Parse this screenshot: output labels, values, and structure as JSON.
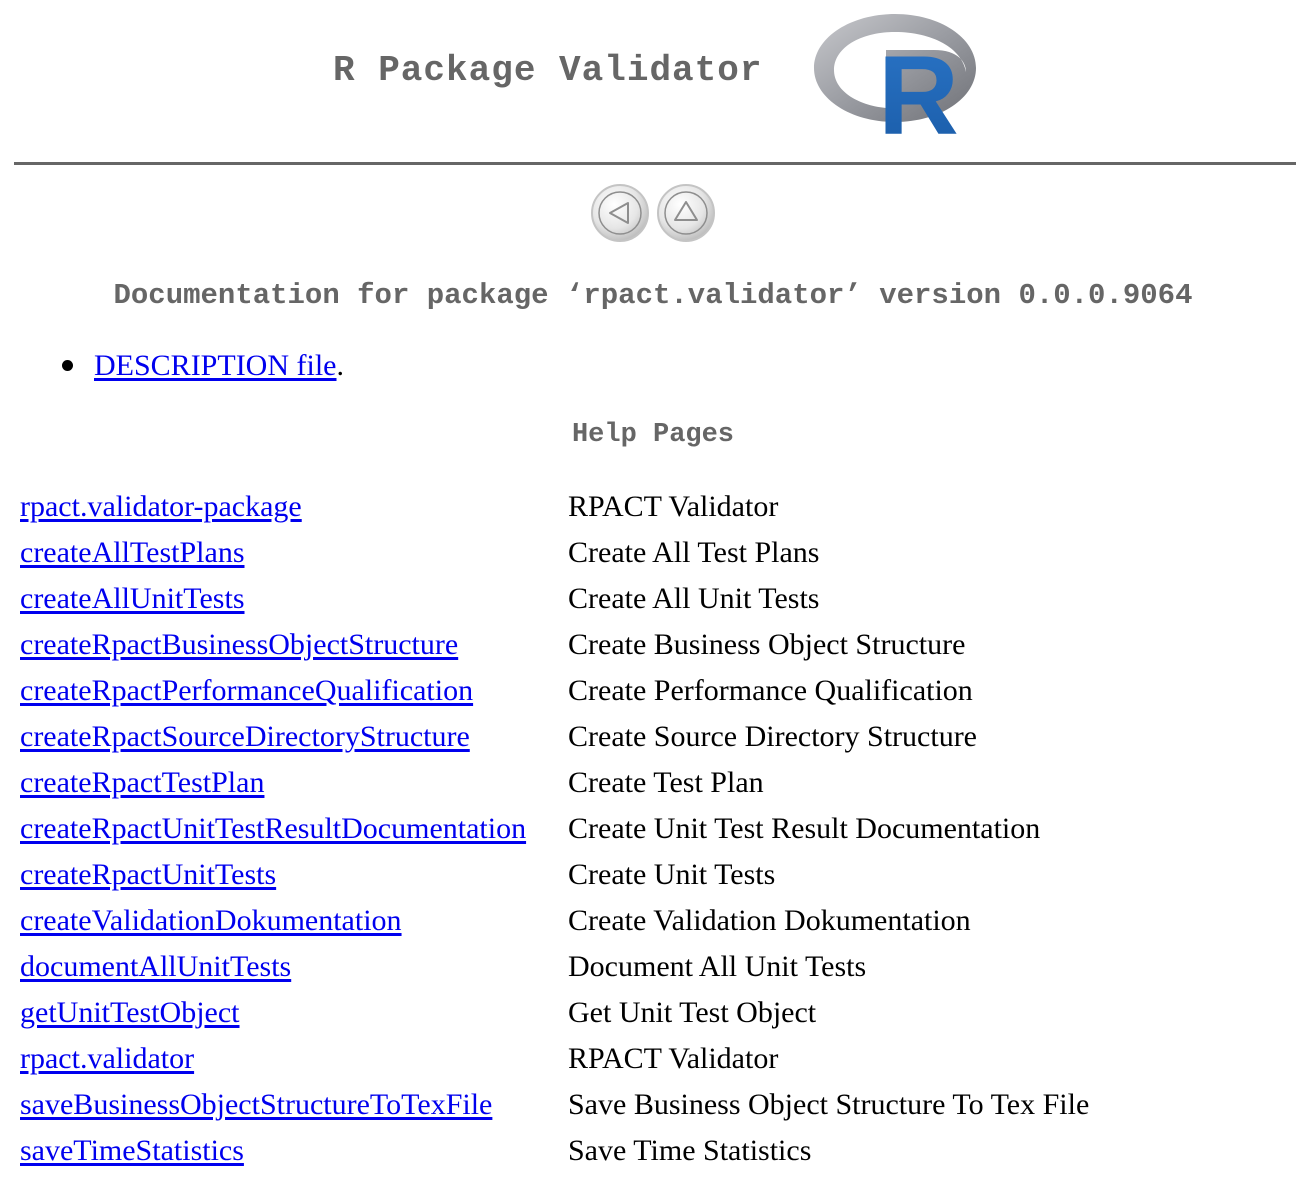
{
  "header": {
    "title": "R Package Validator",
    "logo_letter": "R",
    "logo_colors": {
      "ring": "#9a9ca2",
      "letter": "#2166b8"
    }
  },
  "nav": {
    "back_icon": "left-arrow-circle-icon",
    "up_icon": "up-arrow-circle-icon"
  },
  "doc_title": "Documentation for package ‘rpact.validator’ version 0.0.0.9064",
  "description": {
    "link_text": "DESCRIPTION file",
    "suffix": "."
  },
  "help_heading": "Help Pages",
  "help_pages": [
    {
      "name": "rpact.validator-package",
      "title": "RPACT Validator"
    },
    {
      "name": "createAllTestPlans",
      "title": "Create All Test Plans"
    },
    {
      "name": "createAllUnitTests",
      "title": "Create All Unit Tests"
    },
    {
      "name": "createRpactBusinessObjectStructure",
      "title": "Create Business Object Structure"
    },
    {
      "name": "createRpactPerformanceQualification",
      "title": "Create Performance Qualification"
    },
    {
      "name": "createRpactSourceDirectoryStructure",
      "title": "Create Source Directory Structure"
    },
    {
      "name": "createRpactTestPlan",
      "title": "Create Test Plan"
    },
    {
      "name": "createRpactUnitTestResultDocumentation",
      "title": "Create Unit Test Result Documentation"
    },
    {
      "name": "createRpactUnitTests",
      "title": "Create Unit Tests"
    },
    {
      "name": "createValidationDokumentation",
      "title": "Create Validation Dokumentation"
    },
    {
      "name": "documentAllUnitTests",
      "title": "Document All Unit Tests"
    },
    {
      "name": "getUnitTestObject",
      "title": "Get Unit Test Object"
    },
    {
      "name": "rpact.validator",
      "title": "RPACT Validator"
    },
    {
      "name": "saveBusinessObjectStructureToTexFile",
      "title": "Save Business Object Structure To Tex File"
    },
    {
      "name": "saveTimeStatistics",
      "title": "Save Time Statistics"
    }
  ]
}
